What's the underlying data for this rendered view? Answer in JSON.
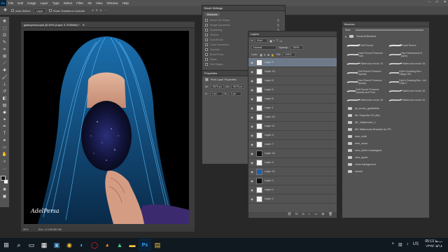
{
  "menubar": {
    "logo": "Ps",
    "items": [
      "File",
      "Edit",
      "Image",
      "Layer",
      "Type",
      "Select",
      "Filter",
      "3D",
      "View",
      "Window",
      "Help"
    ],
    "window_controls": [
      "–",
      "□",
      "✕"
    ]
  },
  "options": {
    "auto_select_label": "Auto-Select:",
    "auto_select_value": "Layer",
    "transform_label": "Show Transform Controls"
  },
  "document": {
    "tab_title": "galaxymood.psd @ 50% (Layer 3, RGB/8#) *",
    "signature": "AdelPersa",
    "zoom": "50%",
    "doc_info": "Doc: 12.1M/180.0M"
  },
  "brush_settings": {
    "title": "Brush Settings",
    "brushes_button": "Brushes",
    "options": [
      "Brush Tip Shape",
      "Shape Dynamics",
      "Scattering",
      "Texture",
      "Dual Brush",
      "Color Dynamics",
      "Transfer",
      "Brush Pose",
      "Noise",
      "Wet Edges",
      "Build-up",
      "Smoothing",
      "Protect Texture"
    ]
  },
  "properties": {
    "title": "Properties",
    "subtitle": "Pixel Layer Properties",
    "w_label": "W:",
    "w_value": "9079 px",
    "h_label": "H:",
    "h_value": "9079 px",
    "x_label": "X:",
    "x_value": "0 px",
    "y_label": "Y:",
    "y_value": "0 px"
  },
  "layers": {
    "title": "Layers",
    "kind_label": "Kind",
    "blend_mode": "Normal",
    "opacity_label": "Opacity:",
    "opacity_value": "100%",
    "lock_label": "Lock:",
    "fill_label": "Fill:",
    "fill_value": "100%",
    "rows": [
      {
        "name": "Layer 3"
      },
      {
        "name": "Layer 13"
      },
      {
        "name": "Layer 6"
      },
      {
        "name": "Layer 5"
      },
      {
        "name": "Layer 8"
      },
      {
        "name": "Layer 1"
      },
      {
        "name": "Layer 10"
      },
      {
        "name": "Layer 11"
      },
      {
        "name": "Layer 9"
      },
      {
        "name": "Layer 7"
      },
      {
        "name": "Layer 14"
      },
      {
        "name": "Layer 4"
      },
      {
        "name": "Layer 12"
      },
      {
        "name": "Layer 2"
      },
      {
        "name": "Layer 0"
      },
      {
        "name": "Layer 2"
      }
    ],
    "footer_icons": [
      "link-icon",
      "fx-icon",
      "mask-icon",
      "adjustment-icon",
      "group-icon",
      "new-layer-icon",
      "trash-icon"
    ]
  },
  "brushes": {
    "title": "Brushes",
    "size_label": "Size:",
    "group_name": "General Brushes",
    "presets": [
      {
        "name": "Soft Round"
      },
      {
        "name": "Hard Round"
      },
      {
        "name": "Hard Round Pressure Size"
      },
      {
        "name": "Hard Mechanical 8 pixels"
      },
      {
        "name": "Watercolor brush 10"
      },
      {
        "name": "Watercolor brush 15"
      },
      {
        "name": "Soft Round Pressure Opacity"
      },
      {
        "name": "Kyle's Drawing Box - Happy HB"
      },
      {
        "name": "Hard Round Pressure Opacity"
      },
      {
        "name": "Kyle's Drawing Box - Art Craft 2"
      },
      {
        "name": "Soft Round Pressure Opacity and Flow"
      },
      {
        "name": "Watercolor brush 25"
      },
      {
        "name": "Watercolor brush 25"
      },
      {
        "name": "Watercolor brush 22"
      }
    ],
    "folders": [
      "jm_brush_guidebline",
      "ML Graphics Ch (Art)",
      "ML_Watercolor_1",
      "MV Watercolor Brushes for PS",
      "new_cloth",
      "new_snow",
      "new_britch massagers",
      "new_spark",
      "circle background",
      "smoke"
    ]
  },
  "taskbar": {
    "icons": [
      "start-icon",
      "search-icon",
      "task-view-icon",
      "calculator-icon",
      "store-icon",
      "chrome-icon",
      "edge-icon",
      "opera-icon",
      "firefox-icon",
      "gallery-icon",
      "folder-icon",
      "photoshop-icon",
      "explorer-icon"
    ],
    "time": "05:13 ب.ظ",
    "date": "۱۳۹۹/۰۵/۱۸",
    "lang": "US"
  }
}
